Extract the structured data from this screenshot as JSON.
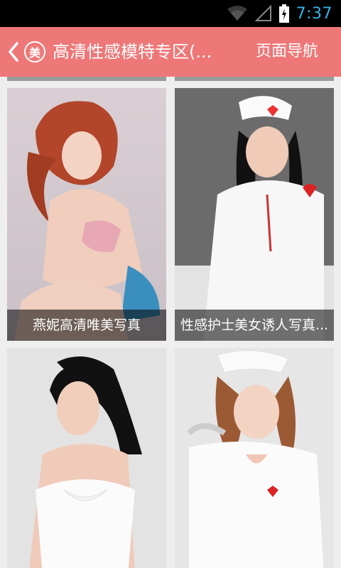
{
  "status_bar": {
    "time": "7:37"
  },
  "action_bar": {
    "title": "高清性感模特专区(...",
    "logo_char": "美",
    "nav_label": "页面导航"
  },
  "cards": [
    {
      "caption": "燕妮高清唯美写真"
    },
    {
      "caption": "性感护士美女诱人写真..."
    },
    {
      "caption": ""
    },
    {
      "caption": ""
    }
  ],
  "colors": {
    "action_bar": "#ee7777",
    "status_accent": "#33b5e5",
    "background": "#eeeeee"
  },
  "icons": [
    "wifi-icon",
    "signal-icon",
    "battery-charging-icon",
    "back-chevron-icon"
  ]
}
